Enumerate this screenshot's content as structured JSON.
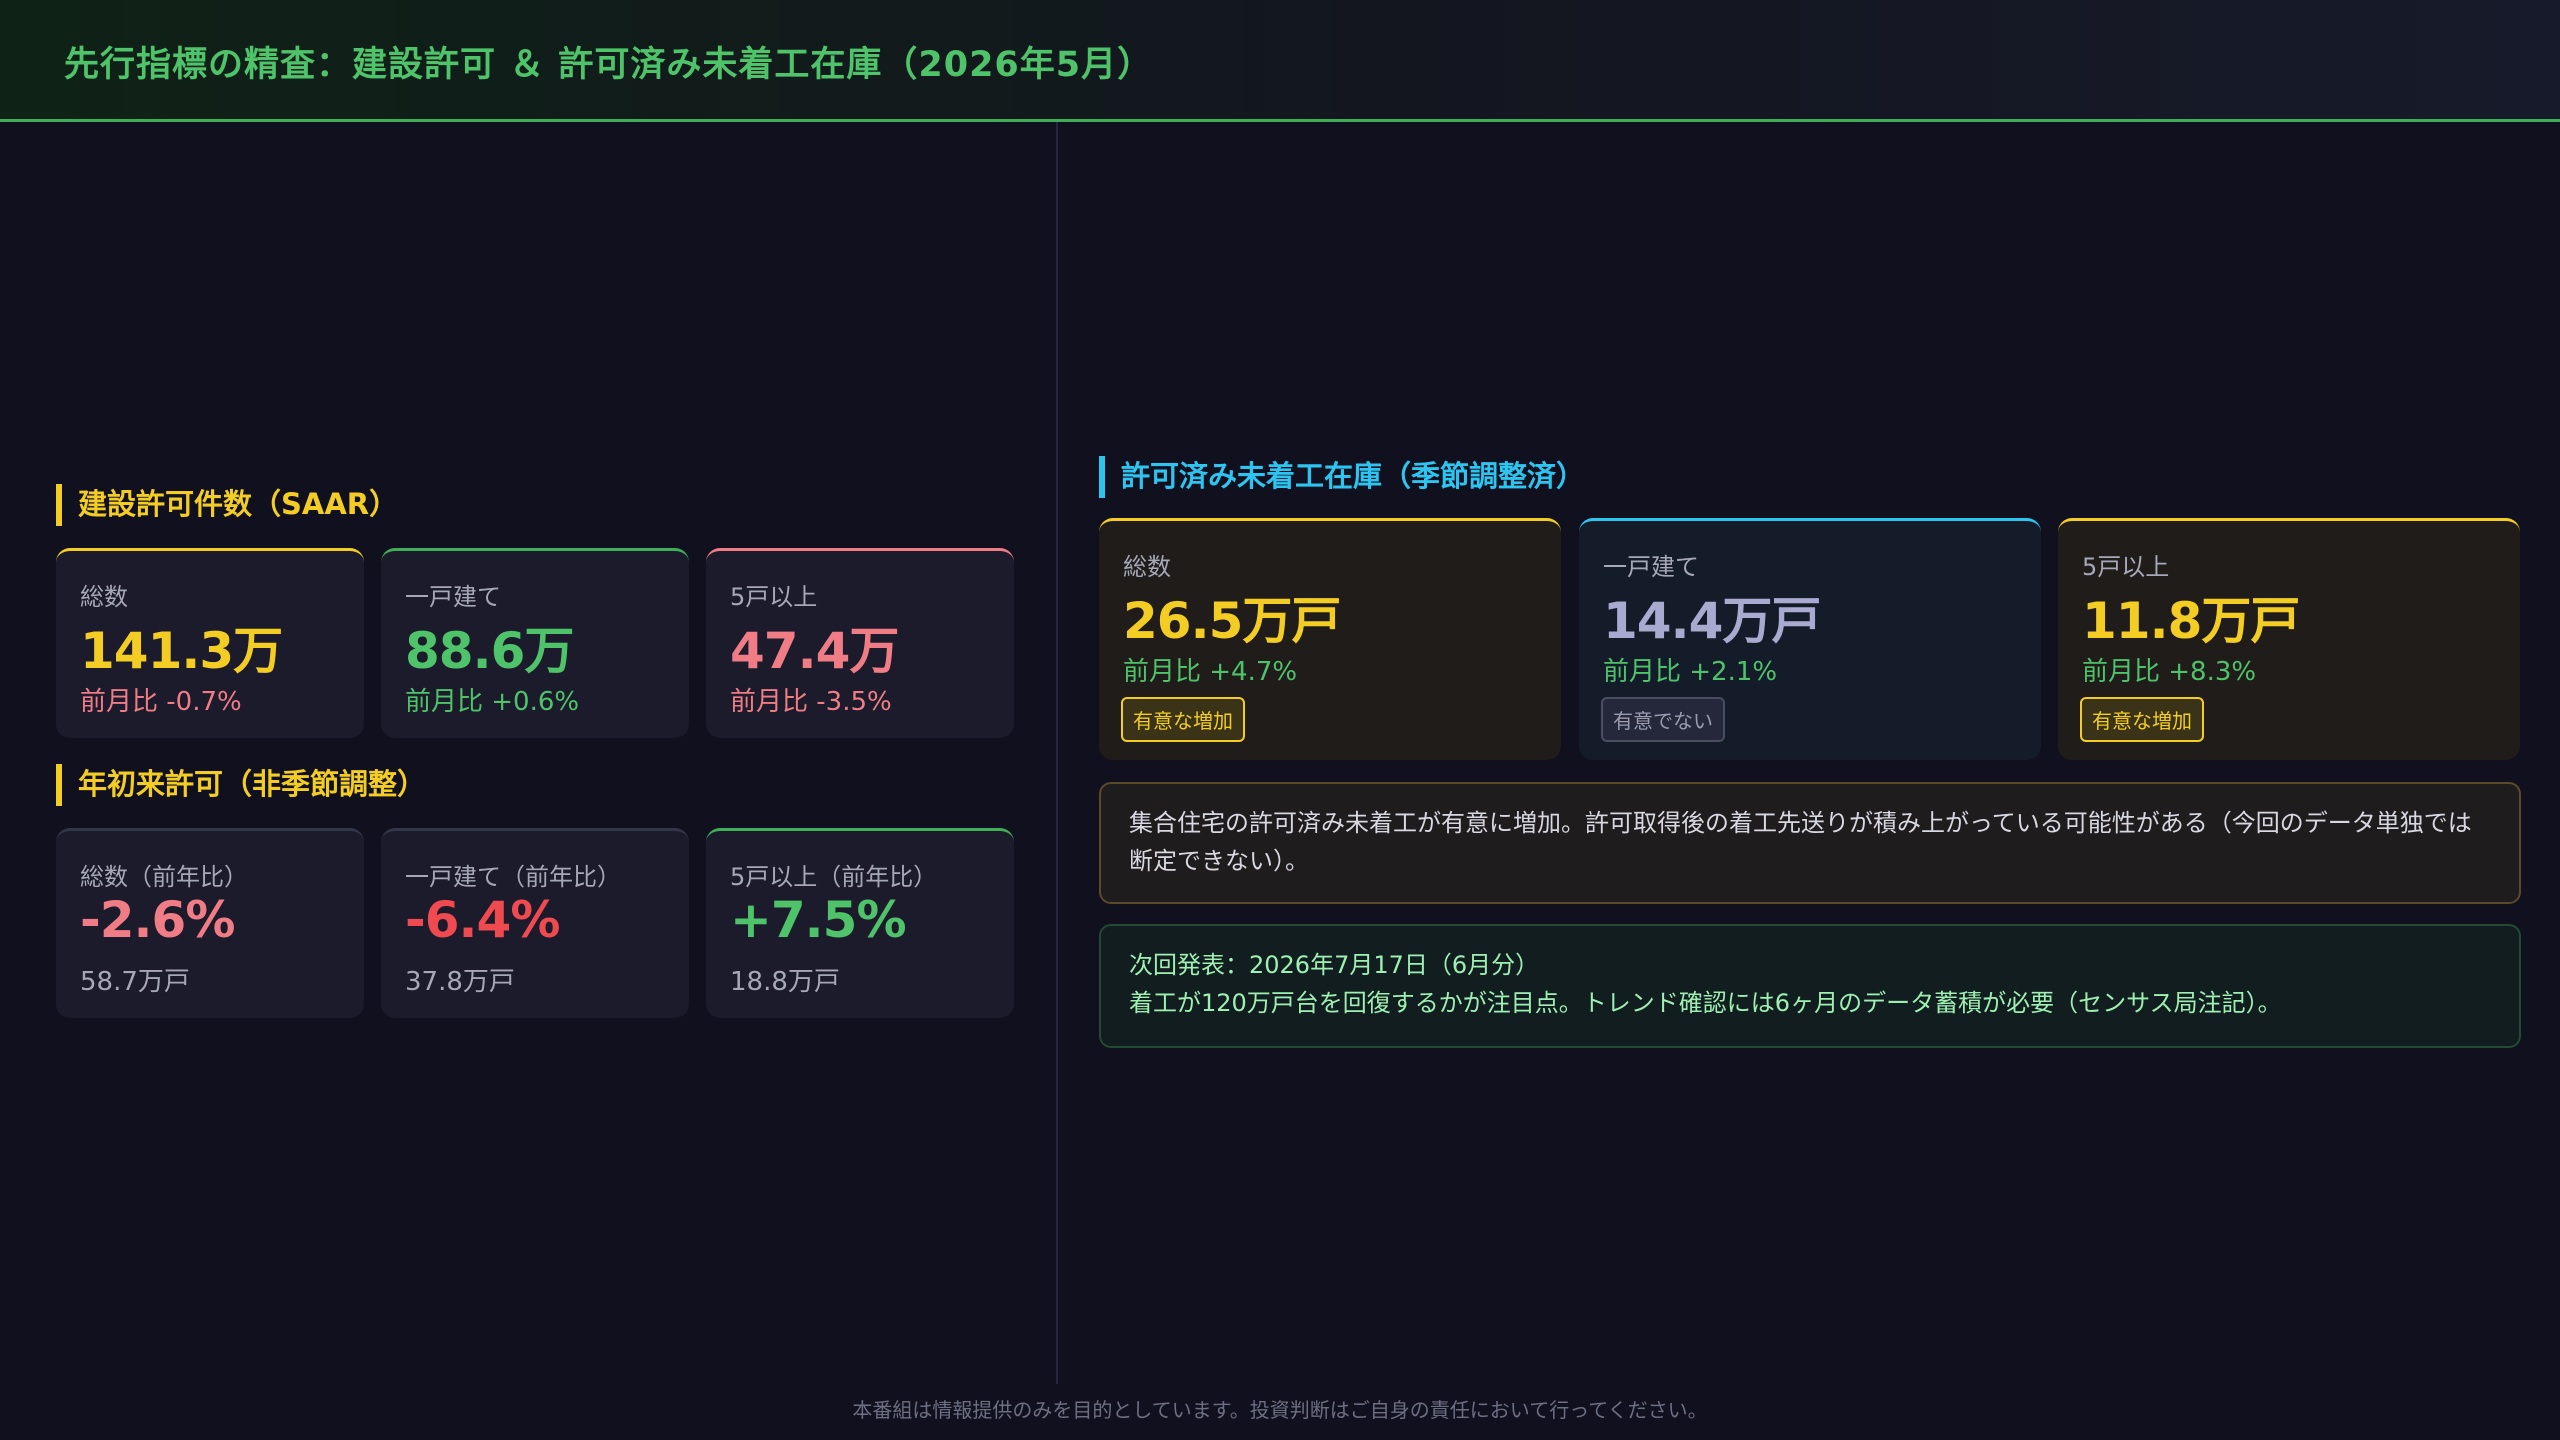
{
  "header": {
    "title": "先行指標の精査：建設許可 ＆ 許可済み未着工在庫（2026年5月）"
  },
  "colors": {
    "accent_green": "#4fc36a",
    "yellow": "#f4cd24",
    "cyan": "#2ec4f0",
    "pink": "#f07c86",
    "red": "#ef4a50",
    "lavender": "#a9aacf"
  },
  "permits": {
    "title": "建設許可件数（SAAR）",
    "cards": [
      {
        "label": "総数",
        "value": "141.3万",
        "change": "前月比 -0.7%"
      },
      {
        "label": "一戸建て",
        "value": "88.6万",
        "change": "前月比 +0.6%"
      },
      {
        "label": "5戸以上",
        "value": "47.4万",
        "change": "前月比 -3.5%"
      }
    ]
  },
  "ytd": {
    "title": "年初来許可（非季節調整）",
    "cards": [
      {
        "label": "総数（前年比）",
        "value": "-2.6%",
        "sub": "58.7万戸"
      },
      {
        "label": "一戸建て（前年比）",
        "value": "-6.4%",
        "sub": "37.8万戸"
      },
      {
        "label": "5戸以上（前年比）",
        "value": "+7.5%",
        "sub": "18.8万戸"
      }
    ]
  },
  "inventory": {
    "title": "許可済み未着工在庫（季節調整済）",
    "cards": [
      {
        "label": "総数",
        "value": "26.5万戸",
        "change": "前月比 +4.7%",
        "badge": "有意な増加"
      },
      {
        "label": "一戸建て",
        "value": "14.4万戸",
        "change": "前月比 +2.1%",
        "badge": "有意でない"
      },
      {
        "label": "5戸以上",
        "value": "11.8万戸",
        "change": "前月比 +8.3%",
        "badge": "有意な増加"
      }
    ]
  },
  "note": {
    "text": "集合住宅の許可済み未着工が有意に増加。許可取得後の着工先送りが積み上がっている可能性がある（今回のデータ単独では断定できない）。"
  },
  "next": {
    "line1": "次回発表：2026年7月17日（6月分）",
    "line2": "着工が120万戸台を回復するかが注目点。トレンド確認には6ヶ月のデータ蓄積が必要（センサス局注記）。"
  },
  "footer": {
    "text": "本番組は情報提供のみを目的としています。投資判断はご自身の責任において行ってください。"
  }
}
